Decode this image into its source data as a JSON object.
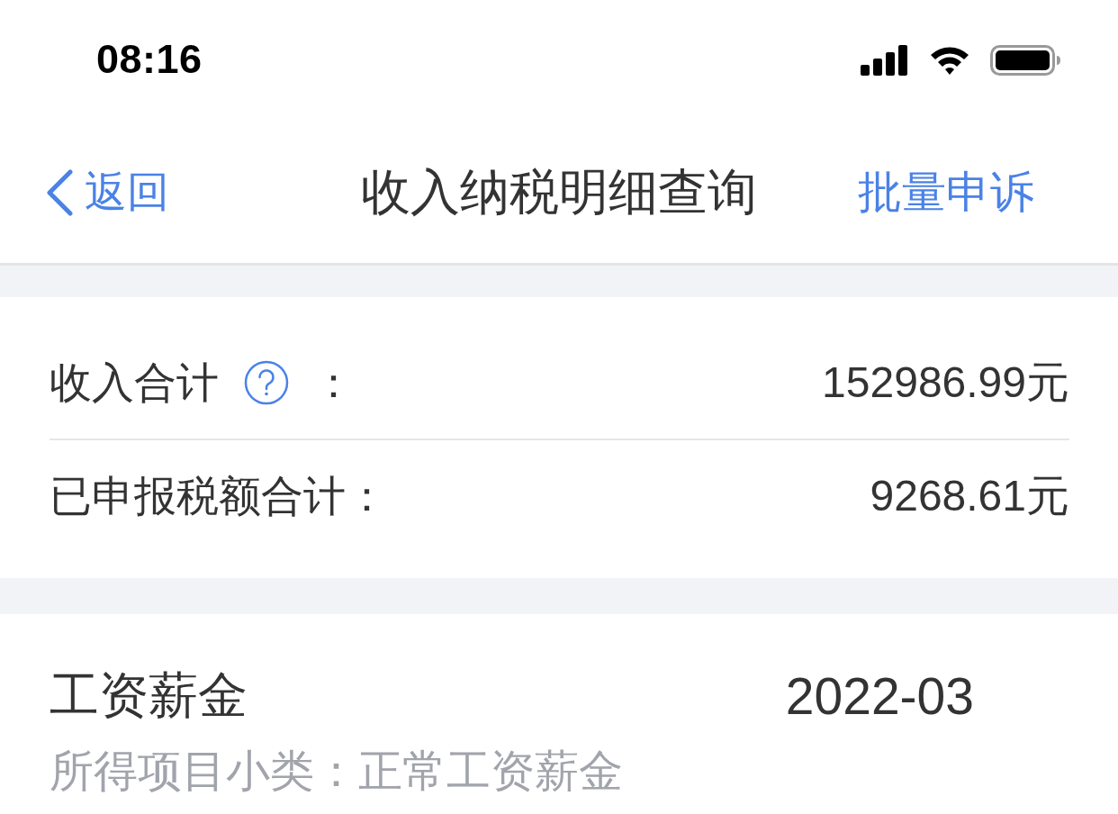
{
  "status_bar": {
    "time": "08:16"
  },
  "nav_bar": {
    "back_label": "返回",
    "title": "收入纳税明细查询",
    "action": "批量申诉"
  },
  "summary": {
    "rows": [
      {
        "label": "收入合计",
        "help": true,
        "suffix": "：",
        "value": "152986.99元"
      },
      {
        "label": "已申报税额合计：",
        "help": false,
        "value": "9268.61元"
      }
    ]
  },
  "records": [
    {
      "category": "工资薪金",
      "period": "2022-03",
      "subcategory": "所得项目小类：正常工资薪金"
    }
  ]
}
